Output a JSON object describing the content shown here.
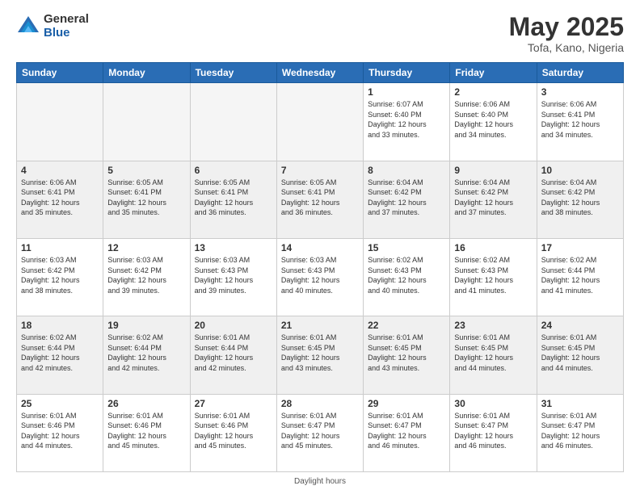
{
  "header": {
    "logo_general": "General",
    "logo_blue": "Blue",
    "title": "May 2025",
    "subtitle": "Tofa, Kano, Nigeria"
  },
  "footer": {
    "text": "Daylight hours"
  },
  "weekdays": [
    "Sunday",
    "Monday",
    "Tuesday",
    "Wednesday",
    "Thursday",
    "Friday",
    "Saturday"
  ],
  "weeks": [
    [
      {
        "day": "",
        "info": ""
      },
      {
        "day": "",
        "info": ""
      },
      {
        "day": "",
        "info": ""
      },
      {
        "day": "",
        "info": ""
      },
      {
        "day": "1",
        "info": "Sunrise: 6:07 AM\nSunset: 6:40 PM\nDaylight: 12 hours\nand 33 minutes."
      },
      {
        "day": "2",
        "info": "Sunrise: 6:06 AM\nSunset: 6:40 PM\nDaylight: 12 hours\nand 34 minutes."
      },
      {
        "day": "3",
        "info": "Sunrise: 6:06 AM\nSunset: 6:41 PM\nDaylight: 12 hours\nand 34 minutes."
      }
    ],
    [
      {
        "day": "4",
        "info": "Sunrise: 6:06 AM\nSunset: 6:41 PM\nDaylight: 12 hours\nand 35 minutes."
      },
      {
        "day": "5",
        "info": "Sunrise: 6:05 AM\nSunset: 6:41 PM\nDaylight: 12 hours\nand 35 minutes."
      },
      {
        "day": "6",
        "info": "Sunrise: 6:05 AM\nSunset: 6:41 PM\nDaylight: 12 hours\nand 36 minutes."
      },
      {
        "day": "7",
        "info": "Sunrise: 6:05 AM\nSunset: 6:41 PM\nDaylight: 12 hours\nand 36 minutes."
      },
      {
        "day": "8",
        "info": "Sunrise: 6:04 AM\nSunset: 6:42 PM\nDaylight: 12 hours\nand 37 minutes."
      },
      {
        "day": "9",
        "info": "Sunrise: 6:04 AM\nSunset: 6:42 PM\nDaylight: 12 hours\nand 37 minutes."
      },
      {
        "day": "10",
        "info": "Sunrise: 6:04 AM\nSunset: 6:42 PM\nDaylight: 12 hours\nand 38 minutes."
      }
    ],
    [
      {
        "day": "11",
        "info": "Sunrise: 6:03 AM\nSunset: 6:42 PM\nDaylight: 12 hours\nand 38 minutes."
      },
      {
        "day": "12",
        "info": "Sunrise: 6:03 AM\nSunset: 6:42 PM\nDaylight: 12 hours\nand 39 minutes."
      },
      {
        "day": "13",
        "info": "Sunrise: 6:03 AM\nSunset: 6:43 PM\nDaylight: 12 hours\nand 39 minutes."
      },
      {
        "day": "14",
        "info": "Sunrise: 6:03 AM\nSunset: 6:43 PM\nDaylight: 12 hours\nand 40 minutes."
      },
      {
        "day": "15",
        "info": "Sunrise: 6:02 AM\nSunset: 6:43 PM\nDaylight: 12 hours\nand 40 minutes."
      },
      {
        "day": "16",
        "info": "Sunrise: 6:02 AM\nSunset: 6:43 PM\nDaylight: 12 hours\nand 41 minutes."
      },
      {
        "day": "17",
        "info": "Sunrise: 6:02 AM\nSunset: 6:44 PM\nDaylight: 12 hours\nand 41 minutes."
      }
    ],
    [
      {
        "day": "18",
        "info": "Sunrise: 6:02 AM\nSunset: 6:44 PM\nDaylight: 12 hours\nand 42 minutes."
      },
      {
        "day": "19",
        "info": "Sunrise: 6:02 AM\nSunset: 6:44 PM\nDaylight: 12 hours\nand 42 minutes."
      },
      {
        "day": "20",
        "info": "Sunrise: 6:01 AM\nSunset: 6:44 PM\nDaylight: 12 hours\nand 42 minutes."
      },
      {
        "day": "21",
        "info": "Sunrise: 6:01 AM\nSunset: 6:45 PM\nDaylight: 12 hours\nand 43 minutes."
      },
      {
        "day": "22",
        "info": "Sunrise: 6:01 AM\nSunset: 6:45 PM\nDaylight: 12 hours\nand 43 minutes."
      },
      {
        "day": "23",
        "info": "Sunrise: 6:01 AM\nSunset: 6:45 PM\nDaylight: 12 hours\nand 44 minutes."
      },
      {
        "day": "24",
        "info": "Sunrise: 6:01 AM\nSunset: 6:45 PM\nDaylight: 12 hours\nand 44 minutes."
      }
    ],
    [
      {
        "day": "25",
        "info": "Sunrise: 6:01 AM\nSunset: 6:46 PM\nDaylight: 12 hours\nand 44 minutes."
      },
      {
        "day": "26",
        "info": "Sunrise: 6:01 AM\nSunset: 6:46 PM\nDaylight: 12 hours\nand 45 minutes."
      },
      {
        "day": "27",
        "info": "Sunrise: 6:01 AM\nSunset: 6:46 PM\nDaylight: 12 hours\nand 45 minutes."
      },
      {
        "day": "28",
        "info": "Sunrise: 6:01 AM\nSunset: 6:47 PM\nDaylight: 12 hours\nand 45 minutes."
      },
      {
        "day": "29",
        "info": "Sunrise: 6:01 AM\nSunset: 6:47 PM\nDaylight: 12 hours\nand 46 minutes."
      },
      {
        "day": "30",
        "info": "Sunrise: 6:01 AM\nSunset: 6:47 PM\nDaylight: 12 hours\nand 46 minutes."
      },
      {
        "day": "31",
        "info": "Sunrise: 6:01 AM\nSunset: 6:47 PM\nDaylight: 12 hours\nand 46 minutes."
      }
    ]
  ]
}
